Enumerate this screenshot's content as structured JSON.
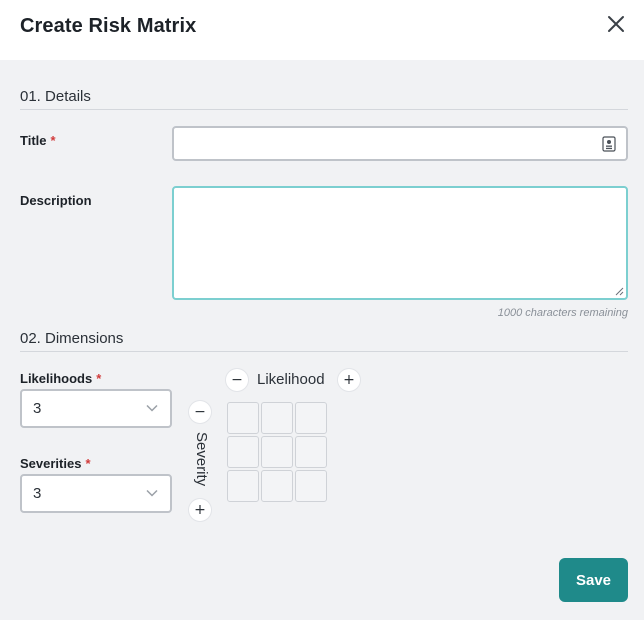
{
  "modal": {
    "title": "Create Risk Matrix",
    "close_icon": "close-icon"
  },
  "details": {
    "heading": "01. Details",
    "title_label": "Title",
    "required_marker": "*",
    "title_value": "",
    "title_icon": "contact-card-icon",
    "description_label": "Description",
    "description_value": "",
    "char_count": "1000 characters remaining"
  },
  "dimensions": {
    "heading": "02. Dimensions",
    "likelihoods_label": "Likelihoods",
    "likelihoods_value": "3",
    "severities_label": "Severities",
    "severities_value": "3",
    "required_marker": "*",
    "likelihood_axis": "Likelihood",
    "severity_axis": "Severity",
    "minus": "−",
    "plus": "+",
    "matrix_rows": 3,
    "matrix_cols": 3
  },
  "footer": {
    "save_label": "Save",
    "accent_color": "#1f8a8a"
  }
}
